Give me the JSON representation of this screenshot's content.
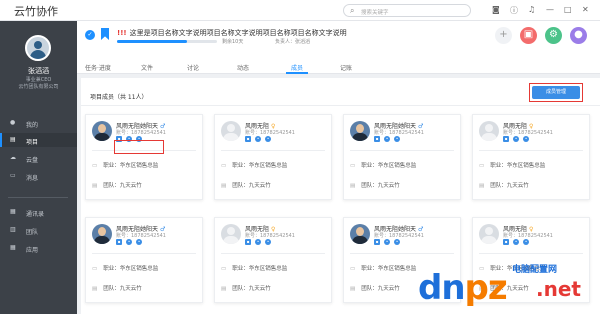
{
  "app": {
    "title": "云竹协作"
  },
  "search": {
    "placeholder": "搜索关键字"
  },
  "user": {
    "name": "张滔滔",
    "role": "事业兼CEO",
    "company": "云竹团队有限公司"
  },
  "sidebar": {
    "items": [
      {
        "label": "我的",
        "icon": "user-icon"
      },
      {
        "label": "项目",
        "icon": "folder-icon"
      },
      {
        "label": "云盘",
        "icon": "cloud-icon"
      },
      {
        "label": "消息",
        "icon": "message-icon"
      },
      {
        "label": "通讯录",
        "icon": "contacts-icon"
      },
      {
        "label": "团队",
        "icon": "team-icon"
      },
      {
        "label": "应用",
        "icon": "apps-icon"
      }
    ],
    "active_index": 1
  },
  "project": {
    "title_prefix": "!!!",
    "title": "这里是项目名称文字说明项目名称文字说明项目名称项目名称文字说明",
    "progress_text": "剩余10天",
    "creator": "负责人：张滔滔"
  },
  "tabs": [
    {
      "label": "任务·进度"
    },
    {
      "label": "文件"
    },
    {
      "label": "讨论"
    },
    {
      "label": "动态"
    },
    {
      "label": "成员"
    },
    {
      "label": "记账"
    }
  ],
  "active_tab": 4,
  "members": {
    "section_title": "项目成员（共 11人）",
    "manage_button": "成员管理",
    "cards": [
      {
        "name": "风雨无阻她阳天",
        "gender": "♂",
        "account": "账号：18782542541",
        "photo": true,
        "position": "职业：华东区销售总监",
        "team": "团队：九天云竹"
      },
      {
        "name": "风雨无阻",
        "gender": "♀",
        "account": "账号：18782542541",
        "photo": false,
        "position": "职业：华东区销售总监",
        "team": "团队：九天云竹"
      },
      {
        "name": "风雨无阻她阳天",
        "gender": "♂",
        "account": "账号：18782542541",
        "photo": true,
        "position": "职业：华东区销售总监",
        "team": "团队：九天云竹"
      },
      {
        "name": "风雨无阻",
        "gender": "♀",
        "account": "账号：18782542541",
        "photo": false,
        "position": "职业：华东区销售总监",
        "team": "团队：九天云竹"
      },
      {
        "name": "风雨无阻她阳天",
        "gender": "♂",
        "account": "账号：18782542541",
        "photo": true,
        "position": "职业：华东区销售总监",
        "team": "团队：九天云竹"
      },
      {
        "name": "风雨无阻",
        "gender": "♀",
        "account": "账号：18782542541",
        "photo": false,
        "position": "职业：华东区销售总监",
        "team": "团队：九天云竹"
      },
      {
        "name": "风雨无阻她阳天",
        "gender": "♂",
        "account": "账号：18782542541",
        "photo": true,
        "position": "职业：华东区销售总监",
        "team": "团队：九天云竹"
      },
      {
        "name": "风雨无阻",
        "gender": "♀",
        "account": "账号：18782542541",
        "photo": false,
        "position": "职业：华东区销售总监",
        "team": "团队：九天云竹"
      }
    ]
  },
  "watermark": {
    "brand": "dnpz",
    "cn": "电脑配置网",
    "domain": ".net"
  },
  "colors": {
    "accent": "#1e90ff",
    "sidebar_bg": "#3c4148",
    "highlight": "#e53935"
  }
}
